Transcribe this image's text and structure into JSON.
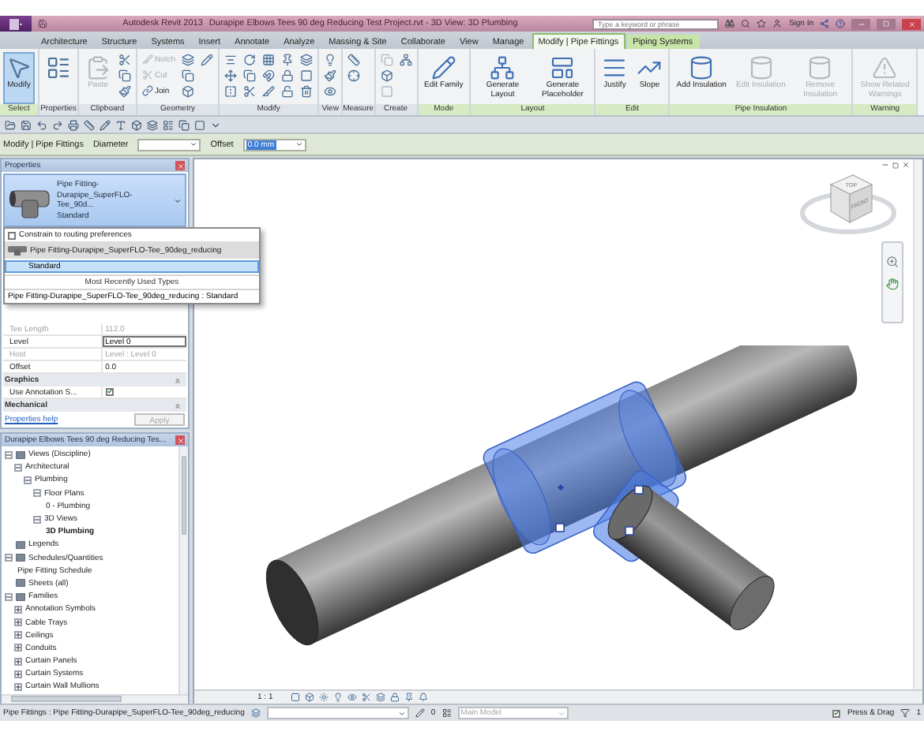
{
  "window": {
    "title": "Autodesk Revit 2013",
    "document": "Durapipe Elbows Tees 90 deg Reducing Test Project.rvt - 3D View: 3D Plumbing",
    "search": {
      "placeholder": "Type a keyword or phrase"
    },
    "sign_in": "Sign In"
  },
  "ribbon_tabs": [
    {
      "label": "Architecture",
      "kind": "standard",
      "selected": false
    },
    {
      "label": "Structure",
      "kind": "standard",
      "selected": false
    },
    {
      "label": "Systems",
      "kind": "standard",
      "selected": false
    },
    {
      "label": "Insert",
      "kind": "standard",
      "selected": false
    },
    {
      "label": "Annotate",
      "kind": "standard",
      "selected": false
    },
    {
      "label": "Analyze",
      "kind": "standard",
      "selected": false
    },
    {
      "label": "Massing & Site",
      "kind": "standard",
      "selected": false
    },
    {
      "label": "Collaborate",
      "kind": "standard",
      "selected": false
    },
    {
      "label": "View",
      "kind": "standard",
      "selected": false
    },
    {
      "label": "Manage",
      "kind": "standard",
      "selected": false
    },
    {
      "label": "Modify | Pipe Fittings",
      "kind": "contextual",
      "selected": true
    },
    {
      "label": "Piping Systems",
      "kind": "contextual",
      "selected": false
    }
  ],
  "ribbon_panels": [
    {
      "label": "Select",
      "kind": "contextual",
      "tools": [
        {
          "kind": "large",
          "label": "Modify",
          "active": true,
          "disabled": false
        }
      ]
    },
    {
      "label": "Properties",
      "kind": "standard",
      "tools": [
        {
          "kind": "large",
          "disabled": false
        }
      ]
    },
    {
      "label": "Clipboard",
      "kind": "standard",
      "tools": [
        {
          "kind": "large",
          "label": "Paste",
          "disabled": true
        },
        {
          "kind": "icon",
          "disabled": false
        },
        {
          "kind": "icon",
          "disabled": false
        },
        {
          "kind": "icon",
          "disabled": false
        }
      ]
    },
    {
      "label": "Geometry",
      "kind": "standard",
      "tools": [
        {
          "kind": "small",
          "label": "Notch",
          "disabled": true
        },
        {
          "kind": "small",
          "label": "Cut",
          "disabled": true
        },
        {
          "kind": "small",
          "label": "Join",
          "disabled": false
        },
        {
          "kind": "icon",
          "disabled": false
        },
        {
          "kind": "icon",
          "disabled": false
        },
        {
          "kind": "icon",
          "disabled": false
        },
        {
          "kind": "icon",
          "disabled": false
        }
      ]
    },
    {
      "label": "Modify",
      "kind": "standard",
      "tools": [
        {
          "kind": "icon",
          "disabled": false
        },
        {
          "kind": "icon",
          "disabled": false
        },
        {
          "kind": "icon",
          "disabled": false
        },
        {
          "kind": "icon",
          "disabled": false
        },
        {
          "kind": "icon",
          "disabled": false
        },
        {
          "kind": "icon",
          "disabled": false
        },
        {
          "kind": "icon",
          "disabled": false
        },
        {
          "kind": "icon",
          "disabled": false
        },
        {
          "kind": "icon",
          "disabled": false
        },
        {
          "kind": "icon",
          "disabled": false
        },
        {
          "kind": "icon",
          "disabled": false
        },
        {
          "kind": "icon",
          "disabled": false
        },
        {
          "kind": "icon",
          "disabled": false
        },
        {
          "kind": "icon",
          "disabled": false
        },
        {
          "kind": "icon",
          "disabled": false
        }
      ]
    },
    {
      "label": "View",
      "kind": "standard",
      "tools": [
        {
          "kind": "icon",
          "disabled": false
        },
        {
          "kind": "icon",
          "disabled": false
        },
        {
          "kind": "icon",
          "disabled": false
        }
      ]
    },
    {
      "label": "Measure",
      "kind": "standard",
      "tools": [
        {
          "kind": "icon",
          "disabled": false
        },
        {
          "kind": "icon",
          "disabled": false
        }
      ]
    },
    {
      "label": "Create",
      "kind": "standard",
      "tools": [
        {
          "kind": "icon",
          "disabled": true
        },
        {
          "kind": "icon",
          "disabled": false
        },
        {
          "kind": "icon",
          "disabled": true
        },
        {
          "kind": "icon",
          "disabled": false
        }
      ]
    },
    {
      "label": "Mode",
      "kind": "contextual",
      "tools": [
        {
          "kind": "large",
          "label": "Edit Family",
          "disabled": false
        }
      ]
    },
    {
      "label": "Layout",
      "kind": "contextual",
      "tools": [
        {
          "kind": "large",
          "label": "Generate Layout",
          "disabled": false
        },
        {
          "kind": "large",
          "label": "Generate Placeholder",
          "disabled": false
        }
      ]
    },
    {
      "label": "Edit",
      "kind": "contextual",
      "tools": [
        {
          "kind": "large",
          "label": "Justify",
          "disabled": false
        },
        {
          "kind": "large",
          "label": "Slope",
          "disabled": false
        }
      ]
    },
    {
      "label": "Pipe Insulation",
      "kind": "contextual",
      "tools": [
        {
          "kind": "large",
          "label": "Add Insulation",
          "disabled": false
        },
        {
          "kind": "large",
          "label": "Edit Insulation",
          "disabled": true
        },
        {
          "kind": "large",
          "label": "Remove Insulation",
          "disabled": true
        }
      ]
    },
    {
      "label": "Warning",
      "kind": "contextual",
      "tools": [
        {
          "kind": "large",
          "label": "Show Related Warnings",
          "disabled": true
        }
      ]
    }
  ],
  "options_bar": {
    "context": "Modify | Pipe Fittings",
    "fields": [
      {
        "label": "Diameter"
      },
      {
        "label": "Offset",
        "value": "0.0 mm"
      }
    ]
  },
  "properties": {
    "title": "Properties",
    "type_selector": [
      "Pipe Fitting-",
      "Durapipe_SuperFLO-Tee_90d...",
      "Standard"
    ],
    "type_dropdown": {
      "constrain": {
        "label": "Constrain to routing preferences",
        "checked": false
      },
      "family": "Pipe Fitting-Durapipe_SuperFLO-Tee_90deg_reducing",
      "types": [
        {
          "label": "Standard",
          "selected": true
        }
      ],
      "recent_heading": "Most Recently Used Types",
      "recent": [
        "Pipe Fitting-Durapipe_SuperFLO-Tee_90deg_reducing : Standard"
      ]
    },
    "rows": [
      {
        "kind": "param",
        "name": "Tee Length",
        "value": "112.0",
        "disabled": true
      },
      {
        "kind": "field",
        "name": "Level",
        "value": "Level 0",
        "disabled": false
      },
      {
        "kind": "param",
        "name": "Host",
        "value": "Level : Level 0",
        "disabled": true
      },
      {
        "kind": "param",
        "name": "Offset",
        "value": "0.0",
        "disabled": false
      },
      {
        "kind": "group",
        "name": "Graphics"
      },
      {
        "kind": "check",
        "name": "Use Annotation S...",
        "checked": true
      },
      {
        "kind": "group",
        "name": "Mechanical"
      }
    ],
    "help_link": "Properties help",
    "apply": {
      "label": "Apply",
      "disabled": true
    }
  },
  "project_browser": {
    "title": "Durapipe Elbows Tees 90 deg Reducing Tes...",
    "tree": [
      {
        "label": "Views (Discipline)",
        "expanded": true,
        "selected": false,
        "children": [
          {
            "label": "Architectural",
            "expanded": true,
            "selected": false,
            "children": [
              {
                "label": "Plumbing",
                "expanded": true,
                "selected": false,
                "children": [
                  {
                    "label": "Floor Plans",
                    "expanded": true,
                    "selected": false,
                    "children": [
                      {
                        "label": "0 - Plumbing",
                        "selected": false
                      }
                    ]
                  },
                  {
                    "label": "3D Views",
                    "expanded": true,
                    "selected": false,
                    "children": [
                      {
                        "label": "3D Plumbing",
                        "selected": true
                      }
                    ]
                  }
                ]
              }
            ]
          }
        ]
      },
      {
        "label": "Legends",
        "selected": false
      },
      {
        "label": "Schedules/Quantities",
        "expanded": true,
        "selected": false,
        "children": [
          {
            "label": "Pipe Fitting Schedule",
            "selected": false
          }
        ]
      },
      {
        "label": "Sheets (all)",
        "selected": false
      },
      {
        "label": "Families",
        "expanded": true,
        "selected": false,
        "children": [
          {
            "label": "Annotation Symbols",
            "expanded": false,
            "selected": false
          },
          {
            "label": "Cable Trays",
            "expanded": false,
            "selected": false
          },
          {
            "label": "Ceilings",
            "expanded": false,
            "selected": false
          },
          {
            "label": "Conduits",
            "expanded": false,
            "selected": false
          },
          {
            "label": "Curtain Panels",
            "expanded": false,
            "selected": false
          },
          {
            "label": "Curtain Systems",
            "expanded": false,
            "selected": false
          },
          {
            "label": "Curtain Wall Mullions",
            "expanded": false,
            "selected": false
          }
        ]
      }
    ]
  },
  "viewport": {
    "view_cube": [
      "TOP",
      "FRONT"
    ],
    "scale": "1 : 1"
  },
  "status_bar": {
    "message": "Pipe Fittings : Pipe Fitting-Durapipe_SuperFLO-Tee_90deg_reducing",
    "editable_count": "0",
    "design_option": "Main Model",
    "press_drag": {
      "label": "Press & Drag",
      "checked": true
    },
    "selection_count": "1"
  }
}
